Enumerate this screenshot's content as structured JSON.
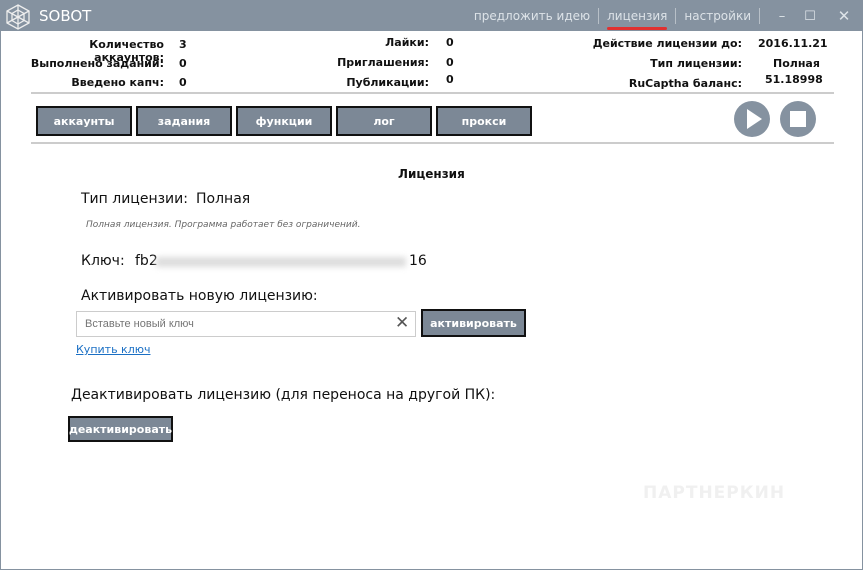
{
  "app": {
    "title": "SOBOT"
  },
  "nav": {
    "suggest": "предложить идею",
    "license": "лицензия",
    "settings": "настройки",
    "minimize": "–",
    "maximize": "☐",
    "close": "✕"
  },
  "stats": {
    "accounts_label": "Количество аккаунтов:",
    "accounts": "3",
    "tasks_label": "Выполнено заданий:",
    "tasks": "0",
    "captcha_label": "Введено капч:",
    "captcha": "0",
    "likes_label": "Лайки:",
    "likes": "0",
    "invites_label": "Приглашения:",
    "invites": "0",
    "posts_label": "Публикации:",
    "posts": "0",
    "license_until_label": "Действие лицензии до:",
    "license_until": "2016.11.21",
    "license_type_label": "Тип лицензии:",
    "license_type": "Полная",
    "rucaptcha_label": "RuCaptha баланс:",
    "rucaptcha": "51.18998"
  },
  "tabs": [
    "аккаунты",
    "задания",
    "функции",
    "лог",
    "прокси"
  ],
  "license": {
    "title": "Лицензия",
    "type_label": "Тип лицензии:",
    "type_value": "Полная",
    "description": "Полная лицензия. Программа работает без ограничений.",
    "key_label": "Ключ:",
    "key_start": "fb2",
    "key_end": "16",
    "activate_label": "Активировать новую лицензию:",
    "input_placeholder": "Вставьте новый ключ",
    "activate_button": "активировать",
    "buy_link": "Купить ключ",
    "deactivate_label": "Деактивировать лицензию (для переноса на другой ПК):",
    "deactivate_button": "деактивировать"
  },
  "watermark": "ПАРТНЕРКИН"
}
